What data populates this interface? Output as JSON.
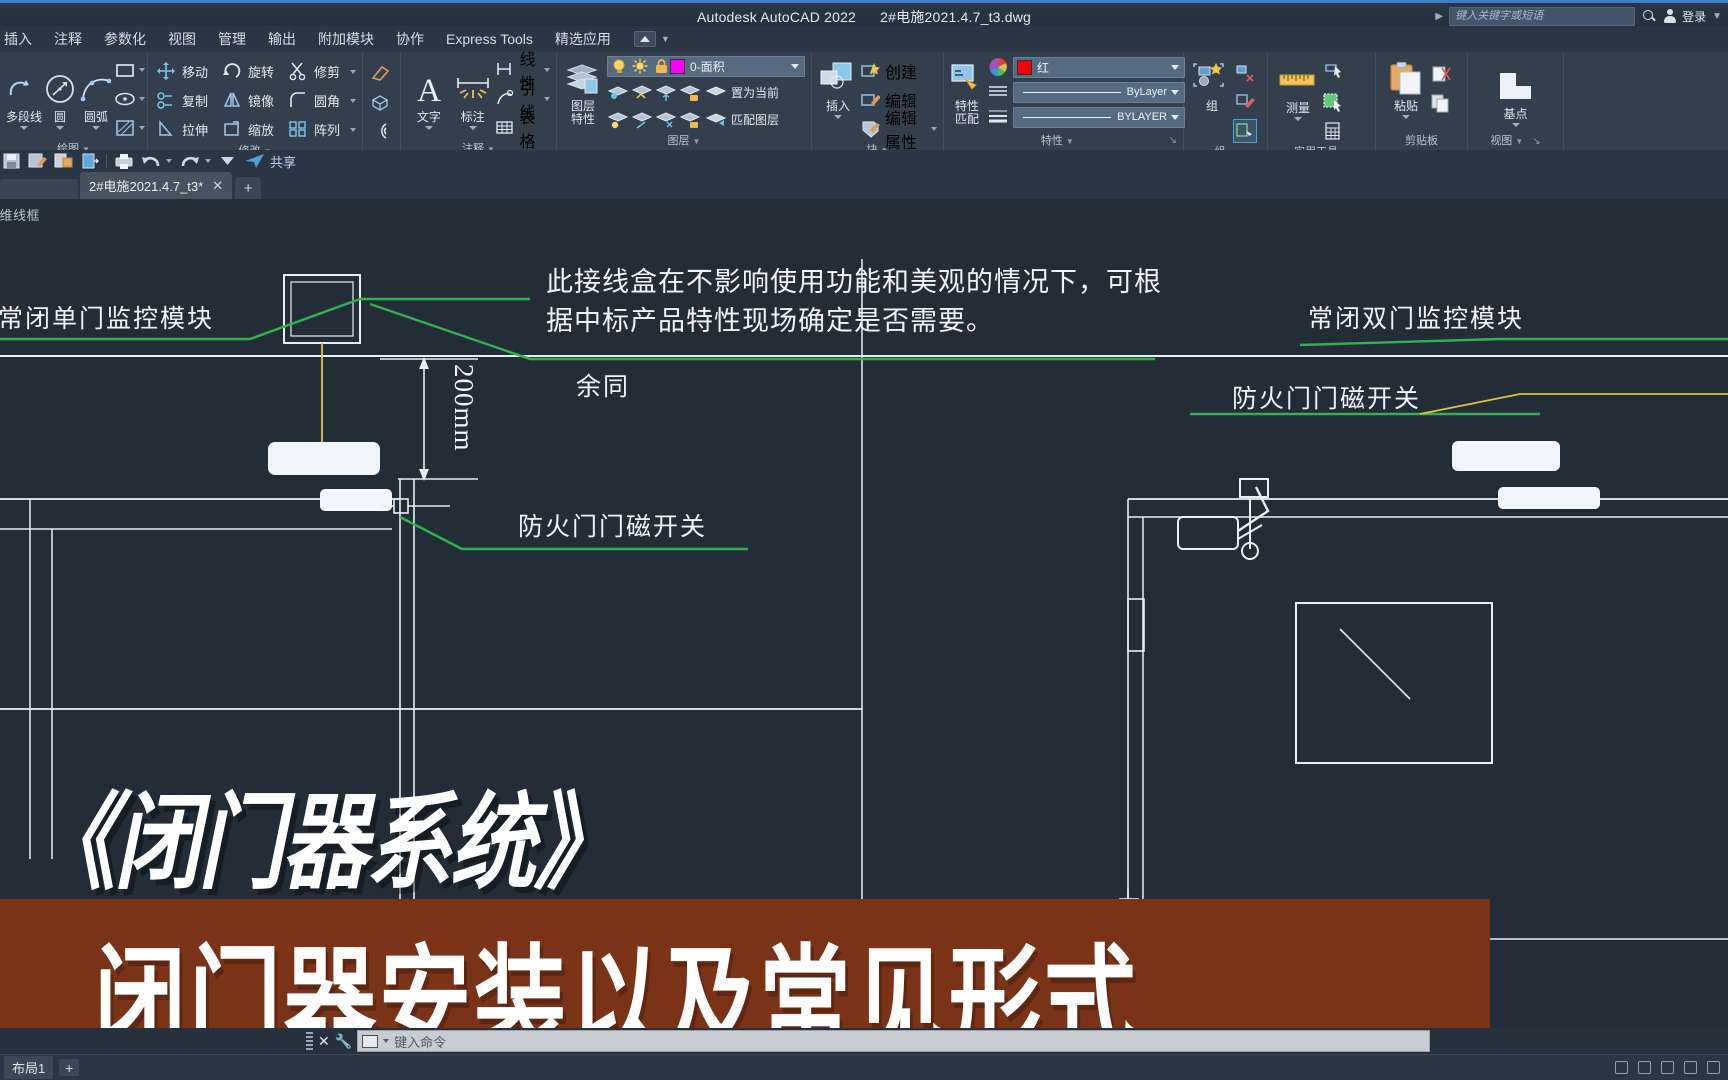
{
  "titlebar": {
    "app_name": "Autodesk AutoCAD 2022",
    "document_name": "2#电施2021.4.7_t3.dwg",
    "search_placeholder": "键入关键字或短语",
    "login_label": "登录",
    "search_icon": "search-icon",
    "account_icon": "person-icon"
  },
  "ribbon_tabs": [
    {
      "label": "插入"
    },
    {
      "label": "注释"
    },
    {
      "label": "参数化"
    },
    {
      "label": "视图"
    },
    {
      "label": "管理"
    },
    {
      "label": "输出"
    },
    {
      "label": "附加模块"
    },
    {
      "label": "协作"
    },
    {
      "label": "Express Tools"
    },
    {
      "label": "精选应用"
    }
  ],
  "ribbon": {
    "panels": [
      {
        "label": "绘图",
        "big_buttons": [
          {
            "label": "多段线",
            "icon": "polyline-icon"
          },
          {
            "label": "圆",
            "icon": "circle-icon"
          },
          {
            "label": "圆弧",
            "icon": "arc-icon"
          }
        ],
        "small_buttons": [
          {
            "label": "",
            "icon": "rectangle-icon"
          },
          {
            "label": "",
            "icon": "ellipse-icon"
          },
          {
            "label": "",
            "icon": "hatch-icon"
          }
        ]
      },
      {
        "label": "修改",
        "small_buttons": [
          {
            "label": "移动",
            "icon": "move-icon"
          },
          {
            "label": "旋转",
            "icon": "rotate-icon"
          },
          {
            "label": "修剪",
            "icon": "trim-icon"
          },
          {
            "label": "复制",
            "icon": "copy-icon"
          },
          {
            "label": "镜像",
            "icon": "mirror-icon"
          },
          {
            "label": "圆角",
            "icon": "fillet-icon"
          },
          {
            "label": "拉伸",
            "icon": "stretch-icon"
          },
          {
            "label": "缩放",
            "icon": "scale-icon"
          },
          {
            "label": "阵列",
            "icon": "array-icon"
          }
        ]
      },
      {
        "label": "注释",
        "big_buttons": [
          {
            "label": "文字",
            "icon": "text-icon"
          },
          {
            "label": "标注",
            "icon": "dimension-icon"
          }
        ],
        "small_buttons": [
          {
            "label": "线性",
            "icon": "linear-dim-icon"
          },
          {
            "label": "引线",
            "icon": "leader-icon"
          },
          {
            "label": "表格",
            "icon": "table-icon"
          }
        ]
      },
      {
        "label": "图层",
        "stack_label_line1": "图层",
        "stack_label_line2": "特性",
        "layer_current": "0-面积",
        "layer_color": "#ff00ff",
        "buttons": [
          {
            "label": "置为当前",
            "icon": "set-current-layer-icon"
          },
          {
            "label": "匹配图层",
            "icon": "match-layer-icon"
          }
        ]
      },
      {
        "label": "块",
        "big_buttons": [
          {
            "label": "插入",
            "icon": "insert-block-icon"
          }
        ],
        "small_buttons": [
          {
            "label": "创建",
            "icon": "create-block-icon"
          },
          {
            "label": "编辑",
            "icon": "edit-block-icon"
          },
          {
            "label": "编辑属性",
            "icon": "edit-attributes-icon"
          }
        ]
      },
      {
        "label": "特性",
        "stack_label_line1": "特性",
        "stack_label_line2": "匹配",
        "color_value": "红",
        "color_hex": "#fb0000",
        "linetype_value": "ByLayer",
        "lineweight_value": "BYLAYER"
      },
      {
        "label": "组",
        "big_buttons": [
          {
            "label": "组",
            "icon": "group-icon"
          }
        ]
      },
      {
        "label": "实用工具",
        "big_buttons": [
          {
            "label": "测量",
            "icon": "measure-icon"
          }
        ]
      },
      {
        "label": "剪贴板",
        "big_buttons": [
          {
            "label": "粘贴",
            "icon": "paste-icon"
          }
        ]
      },
      {
        "label": "视图",
        "big_buttons": [
          {
            "label": "基点",
            "icon": "base-point-icon"
          }
        ]
      }
    ]
  },
  "quick_access": {
    "share_label": "共享",
    "icons": [
      "save-icon",
      "save-as-icon",
      "open-icon",
      "export-icon",
      "plot-icon",
      "undo-icon",
      "redo-icon",
      "customize-icon",
      "share-icon"
    ]
  },
  "file_tabs": {
    "tabs": [
      {
        "label": "2#电施2021.4.7_t3*",
        "close_icon": "close-icon"
      }
    ],
    "new_tab_label": "+"
  },
  "canvas": {
    "viewport_control": "二维线框",
    "annotations": [
      {
        "id": "a1",
        "text": "常闭单门监控模块"
      },
      {
        "id": "a2",
        "text": "此接线盒在不影响使用功能和美观的情况下，可根\n据中标产品特性现场确定是否需要。"
      },
      {
        "id": "a3",
        "text": "余同"
      },
      {
        "id": "a4",
        "text": "常闭双门监控模块"
      },
      {
        "id": "a5",
        "text": "防火门门磁开关"
      },
      {
        "id": "a6",
        "text": "防火门门磁开关"
      },
      {
        "id": "a7",
        "text": "200mm"
      }
    ]
  },
  "overlay": {
    "title": "《闭门器系统》",
    "subtitle": "闭门器安装以及常见形式",
    "banner_color": "#7a3317"
  },
  "command_line": {
    "placeholder": "键入命令",
    "close_icon": "close-icon",
    "settings_icon": "wrench-icon"
  },
  "status_bar": {
    "layout_tab": "布局1",
    "add_layout": "+"
  }
}
